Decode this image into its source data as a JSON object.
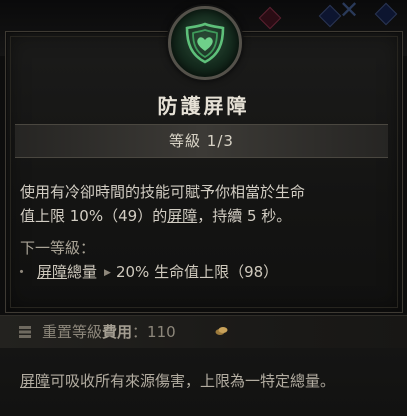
{
  "skill": {
    "title": "防護屏障",
    "rank": "等級 1/3",
    "icon": "green-shield-heart-icon"
  },
  "description": {
    "line1": "使用有冷卻時間的技能可賦予你相當於生命",
    "line2_prefix": "值上限 10%（49）的",
    "line2_keyword": "屏障",
    "line2_suffix": "，持續 5 秒。"
  },
  "next_rank": {
    "header": "下一等級：",
    "bullet": "・",
    "keyword": "屏障",
    "label_suffix": "總量",
    "arrow": "▶",
    "value": "20% 生命值上限（98）"
  },
  "reset": {
    "label": "重置等級",
    "label_bold": "費用",
    "colon": "：",
    "cost": "110"
  },
  "glossary": {
    "keyword": "屏障",
    "text": "可吸收所有來源傷害，上限為一特定總量。"
  },
  "colors": {
    "accent_green": "#4fa86a",
    "text_primary": "#e6e1d6",
    "panel_border": "#3e3a33"
  }
}
